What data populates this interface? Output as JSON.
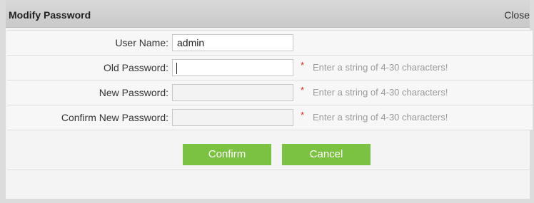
{
  "dialog": {
    "title": "Modify Password",
    "close_label": "Close"
  },
  "form": {
    "fields": [
      {
        "label": "User Name:",
        "value": "admin",
        "required": false,
        "hint": ""
      },
      {
        "label": "Old Password:",
        "value": "",
        "required": true,
        "hint": "Enter a string of 4-30 characters!"
      },
      {
        "label": "New Password:",
        "value": "",
        "required": true,
        "hint": "Enter a string of 4-30 characters!"
      },
      {
        "label": "Confirm New Password:",
        "value": "",
        "required": true,
        "hint": "Enter a string of 4-30 characters!"
      }
    ],
    "required_mark": "*"
  },
  "buttons": {
    "confirm_label": "Confirm",
    "cancel_label": "Cancel"
  },
  "colors": {
    "button_green": "#7cc242",
    "required_red": "#e0261a",
    "hint_gray": "#9a9a9a"
  }
}
